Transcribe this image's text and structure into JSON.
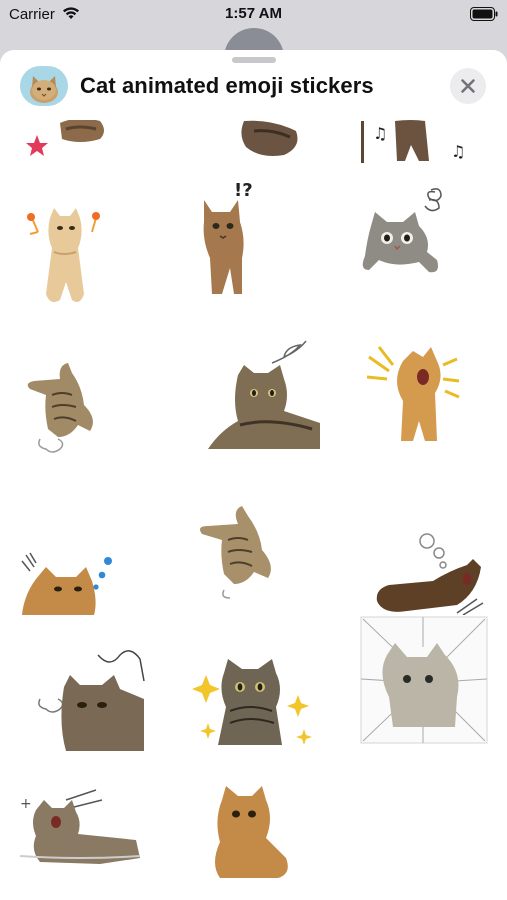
{
  "status_bar": {
    "carrier": "Carrier",
    "time": "1:57 AM",
    "icons": [
      "wifi-icon",
      "battery-icon"
    ]
  },
  "sheet": {
    "title": "Cat animated emoji stickers",
    "app_icon": "cat-app-icon",
    "close_icon": "close-icon"
  },
  "stickers": [
    {
      "name": "sticker-cat-red-star-partial"
    },
    {
      "name": "sticker-cat-curled-partial"
    },
    {
      "name": "sticker-cat-music-notes-partial"
    },
    {
      "name": "sticker-cat-standing-sparkles"
    },
    {
      "name": "sticker-cat-confused-exclamation-question"
    },
    {
      "name": "sticker-cat-peeking-swirl"
    },
    {
      "name": "sticker-cat-rolling-tabby"
    },
    {
      "name": "sticker-cat-lying-tabby-scribble"
    },
    {
      "name": "sticker-cat-orange-yelling"
    },
    {
      "name": "sticker-cat-orange-sweat-drops"
    },
    {
      "name": "sticker-cat-rolling-tabby-puff"
    },
    {
      "name": "sticker-cat-yawning-thought-bubbles"
    },
    {
      "name": "sticker-cat-grumpy-puff"
    },
    {
      "name": "sticker-cat-tabby-sparkles"
    },
    {
      "name": "sticker-cat-shocked-speed-lines"
    },
    {
      "name": "sticker-cat-lying-yawn-wind"
    },
    {
      "name": "sticker-cat-orange-nervous-sweat"
    }
  ],
  "colors": {
    "sheet": "#ffffff",
    "close_bg": "#ececef",
    "close_glyph": "#737378"
  }
}
